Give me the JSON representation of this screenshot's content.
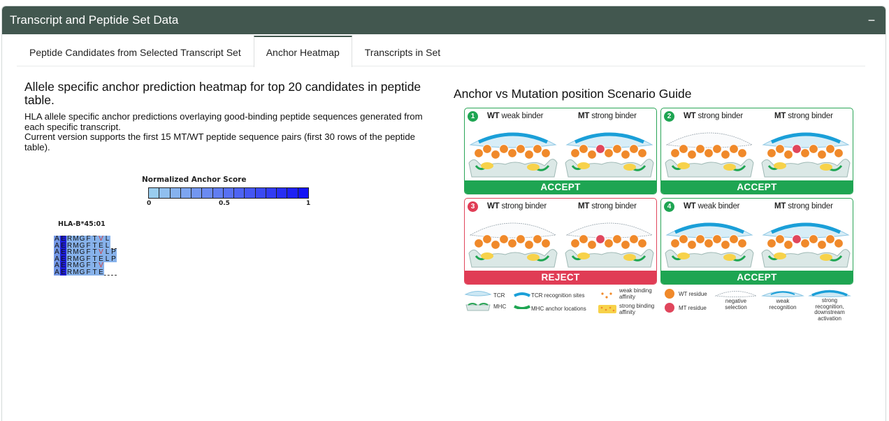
{
  "header": {
    "title": "Transcript and Peptide Set Data",
    "collapse_glyph": "−"
  },
  "tabs": [
    {
      "label": "Peptide Candidates from Selected Transcript Set",
      "active": false
    },
    {
      "label": "Anchor Heatmap",
      "active": true
    },
    {
      "label": "Transcripts in Set",
      "active": false
    }
  ],
  "left": {
    "heading": "Allele specific anchor prediction heatmap for top 20 candidates in peptide table.",
    "desc1": "HLA allele specific anchor predictions overlaying good-binding peptide sequences generated from each specific transcript.",
    "desc2": "Current version supports the first 15 MT/WT peptide sequence pairs (first 30 rows of the peptide table)."
  },
  "heatmap": {
    "legend_title": "Normalized Anchor Score",
    "tick_min": "0",
    "tick_mid": "0.5",
    "tick_max": "1",
    "allele": "HLA-B*45:01",
    "peptides": [
      "AERMGFTVL",
      "AERMGFTEL",
      "AERMGFTVLP",
      "AERMGFTELP",
      "AERMGFTV",
      "AERMGFTE"
    ]
  },
  "guide": {
    "title": "Anchor vs Mutation position Scenario Guide",
    "panels": [
      {
        "num": "1",
        "wt": "WT",
        "wt_text": " weak binder",
        "mt": "MT",
        "mt_text": " strong binder",
        "result": "ACCEPT"
      },
      {
        "num": "2",
        "wt": "WT",
        "wt_text": " strong binder",
        "mt": "MT",
        "mt_text": " strong binder",
        "result": "ACCEPT"
      },
      {
        "num": "3",
        "wt": "WT",
        "wt_text": " strong binder",
        "mt": "MT",
        "mt_text": " strong binder",
        "result": "REJECT"
      },
      {
        "num": "4",
        "wt": "WT",
        "wt_text": " weak binder",
        "mt": "MT",
        "mt_text": " strong binder",
        "result": "ACCEPT"
      }
    ],
    "legend": {
      "tcr": "TCR",
      "mhc": "MHC",
      "tcr_sites": "TCR recognition sites",
      "mhc_anchor": "MHC anchor locations",
      "weak_affinity": "weak binding affinity",
      "strong_affinity": "strong binding affinity",
      "wt_residue": "WT residue",
      "mt_residue": "MT residue",
      "neg_selection": "negative selection",
      "weak_recognition": "weak recognition",
      "strong_recognition": "strong recognition, downstream activation"
    }
  },
  "colors": {
    "header": "#42574f",
    "accept": "#1ea552",
    "reject": "#e03c55",
    "residue_wt": "#f0892a",
    "residue_mt": "#e0465c"
  }
}
